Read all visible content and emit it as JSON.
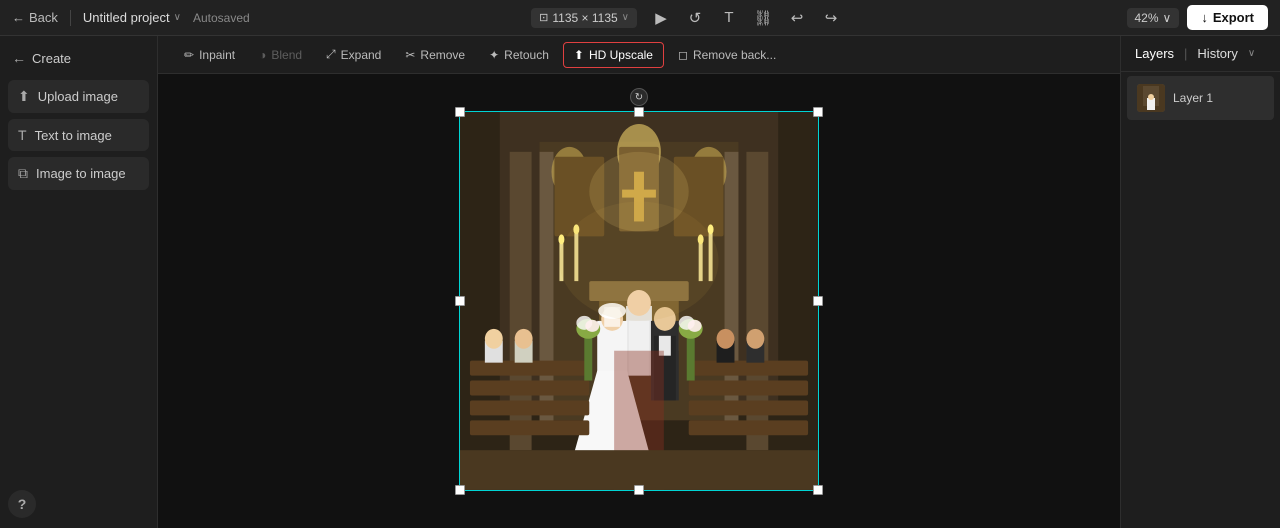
{
  "topbar": {
    "back_label": "Back",
    "project_title": "Untitled project",
    "autosaved_label": "Autosaved",
    "dimensions": "1135 × 1135",
    "zoom_level": "42%",
    "export_label": "Export"
  },
  "toolbar": {
    "inpaint_label": "Inpaint",
    "blend_label": "Blend",
    "expand_label": "Expand",
    "remove_label": "Remove",
    "retouch_label": "Retouch",
    "hd_upscale_label": "HD Upscale",
    "remove_back_label": "Remove back..."
  },
  "left_sidebar": {
    "create_label": "Create",
    "upload_image_label": "Upload image",
    "text_to_image_label": "Text to image",
    "image_to_image_label": "Image to image"
  },
  "right_sidebar": {
    "layers_label": "Layers",
    "history_label": "History",
    "layer1_label": "Layer 1"
  },
  "help_label": "?",
  "icons": {
    "back_arrow": "←",
    "chevron_down": "∨",
    "play": "▶",
    "refresh": "↺",
    "text": "T",
    "link": "⛓",
    "undo": "↩",
    "redo": "↪",
    "upload": "↑",
    "image": "🖼",
    "type": "T",
    "img2img": "⧉",
    "rotate": "↻",
    "inpaint": "✏",
    "blend": "◑",
    "expand": "⤢",
    "remove": "✂",
    "retouch": "✦",
    "hd": "⬆",
    "remove_back": "◻"
  }
}
